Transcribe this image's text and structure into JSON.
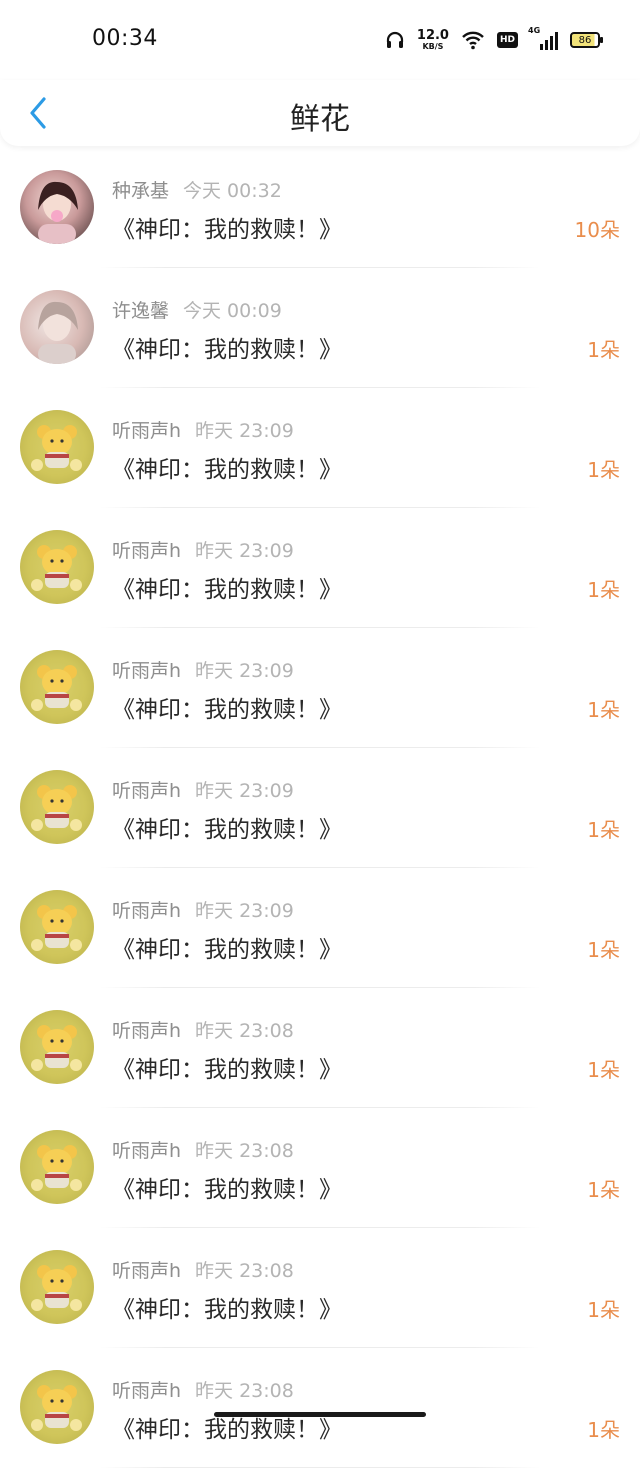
{
  "status_bar": {
    "time": "00:34",
    "net_speed_value": "12.0",
    "net_speed_unit": "KB/S",
    "hd_label": "HD",
    "signal_label": "4G",
    "battery": "86"
  },
  "header": {
    "title": "鲜花"
  },
  "items": [
    {
      "name": "种承基",
      "time": "今天 00:32",
      "work": "《神印：我的救赎！》",
      "count": "10朵",
      "avatar": "girl-avatar"
    },
    {
      "name": "许逸馨",
      "time": "今天 00:09",
      "work": "《神印：我的救赎！》",
      "count": "1朵",
      "avatar": "girl-avatar"
    },
    {
      "name": "听雨声h",
      "time": "昨天 23:09",
      "work": "《神印：我的救赎！》",
      "count": "1朵",
      "avatar": "bear-avatar"
    },
    {
      "name": "听雨声h",
      "time": "昨天 23:09",
      "work": "《神印：我的救赎！》",
      "count": "1朵",
      "avatar": "bear-avatar"
    },
    {
      "name": "听雨声h",
      "time": "昨天 23:09",
      "work": "《神印：我的救赎！》",
      "count": "1朵",
      "avatar": "bear-avatar"
    },
    {
      "name": "听雨声h",
      "time": "昨天 23:09",
      "work": "《神印：我的救赎！》",
      "count": "1朵",
      "avatar": "bear-avatar"
    },
    {
      "name": "听雨声h",
      "time": "昨天 23:09",
      "work": "《神印：我的救赎！》",
      "count": "1朵",
      "avatar": "bear-avatar"
    },
    {
      "name": "听雨声h",
      "time": "昨天 23:08",
      "work": "《神印：我的救赎！》",
      "count": "1朵",
      "avatar": "bear-avatar"
    },
    {
      "name": "听雨声h",
      "time": "昨天 23:08",
      "work": "《神印：我的救赎！》",
      "count": "1朵",
      "avatar": "bear-avatar"
    },
    {
      "name": "听雨声h",
      "time": "昨天 23:08",
      "work": "《神印：我的救赎！》",
      "count": "1朵",
      "avatar": "bear-avatar"
    },
    {
      "name": "听雨声h",
      "time": "昨天 23:08",
      "work": "《神印：我的救赎！》",
      "count": "1朵",
      "avatar": "bear-avatar"
    }
  ],
  "colors": {
    "accent": "#2c9be5",
    "count": "#e98d4c",
    "name": "#8e8e8e"
  }
}
